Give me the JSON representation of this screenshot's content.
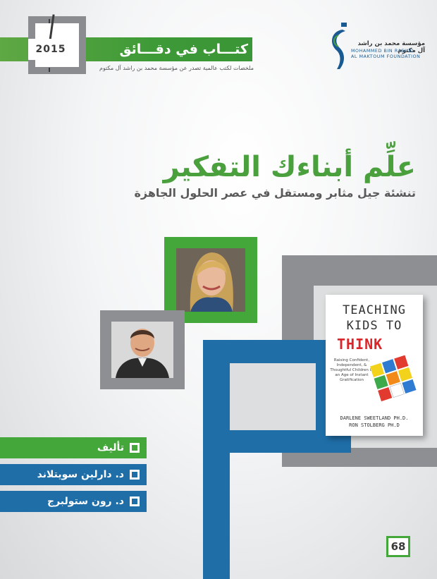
{
  "header": {
    "year": "2015",
    "series_title": "كتـــاب في دقـــائق",
    "subtitle": "ملخصات لكتب عالمية تصدر عن مؤسسة محمد بن راشد آل مكتوم"
  },
  "organization": {
    "name_ar": "مؤسسة محمد بن راشد آل مكتوم",
    "name_en_line1": "MOHAMMED BIN RASHID",
    "name_en_line2": "AL MAKTOUM FOUNDATION"
  },
  "title": {
    "main": "علِّم أبناءك التفكير",
    "sub": "تنشئة جيل مثابر ومستقل في عصر الحلول الجاهزة"
  },
  "book_cover": {
    "line1": "TEACHING",
    "line2": "KIDS TO",
    "line3": "THINK",
    "tagline": "Raising Confident, Independent, & Thoughtful Children in an Age of Instant Gratification",
    "author1": "DARLENE SWEETLAND PH.D.",
    "author2": "RON STOLBERG PH.D"
  },
  "authors": {
    "label": "تأليف",
    "author1": "د. دارلين سويتلاند",
    "author2": "د. رون ستولبرج"
  },
  "page_number": "68",
  "colors": {
    "green": "#43a73a",
    "blue": "#1f6ea8",
    "grey": "#8d8f92"
  }
}
